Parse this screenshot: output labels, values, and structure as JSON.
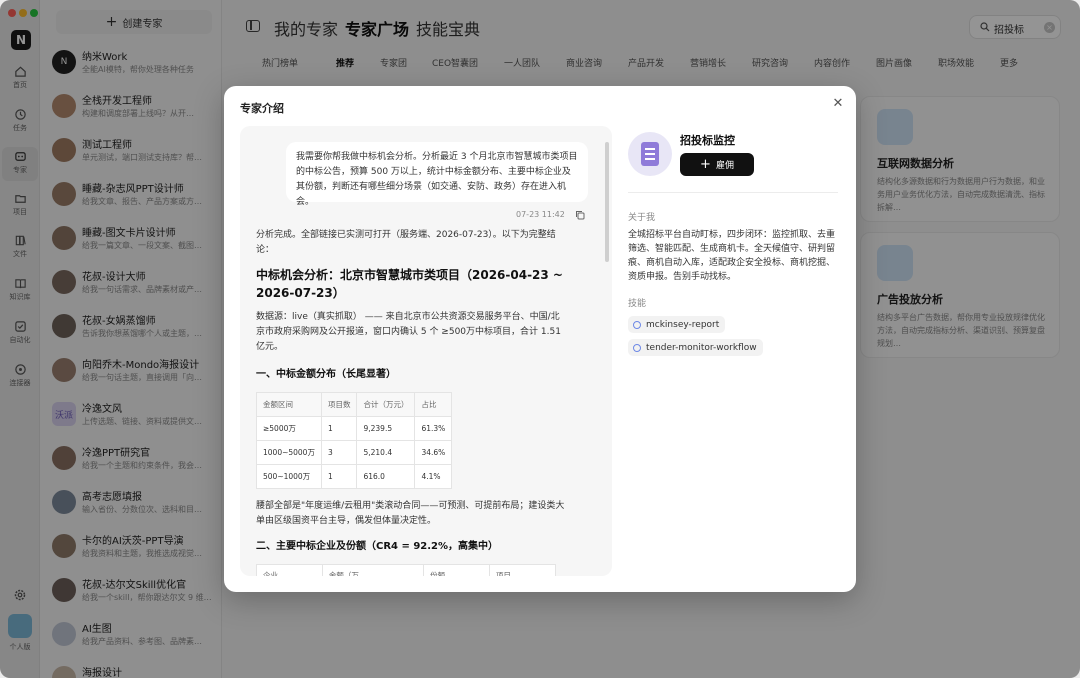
{
  "window": {
    "traffic_lights": [
      "#ff5f57",
      "#febc2e",
      "#28c840"
    ]
  },
  "rail": {
    "logo": "N",
    "items": [
      {
        "label": "首页",
        "icon": "home-icon"
      },
      {
        "label": "任务",
        "icon": "task-icon"
      },
      {
        "label": "专家",
        "icon": "expert-icon",
        "active": true
      },
      {
        "label": "项目",
        "icon": "folder-icon"
      },
      {
        "label": "文件",
        "icon": "file-icon"
      },
      {
        "label": "知识库",
        "icon": "book-icon"
      },
      {
        "label": "自动化",
        "icon": "automation-icon"
      },
      {
        "label": "连接器",
        "icon": "connector-icon"
      }
    ],
    "settings_icon": "gear-icon",
    "profile_label": "个人版"
  },
  "sidebar": {
    "create_label": "创建专家",
    "experts": [
      {
        "name": "纳米Work",
        "desc": "全能AI模特，帮你处理各种任务",
        "avatar_text": "N",
        "avatar_color": "#222222"
      },
      {
        "name": "全栈开发工程师",
        "desc": "构建和调度部署上线吗？从开…",
        "avatar_text": "",
        "avatar_color": "#b48a6e"
      },
      {
        "name": "测试工程师",
        "desc": "单元测试，端口测试支持库？帮…",
        "avatar_text": "",
        "avatar_color": "#a07c63"
      },
      {
        "name": "睡藏-杂志风PPT设计师",
        "desc": "给我文章、报告、产品方案或方…",
        "avatar_text": "",
        "avatar_color": "#9a7d68"
      },
      {
        "name": "睡藏-图文卡片设计师",
        "desc": "给我一篇文章、一段文案、截图…",
        "avatar_text": "",
        "avatar_color": "#8d7565"
      },
      {
        "name": "花叔-设计大师",
        "desc": "给我一句话需求、品牌素材或产…",
        "avatar_text": "",
        "avatar_color": "#7b6a60"
      },
      {
        "name": "花叔-女娲蒸馏师",
        "desc": "告诉我你想蒸馏哪个人或主题，…",
        "avatar_text": "",
        "avatar_color": "#6f625b"
      },
      {
        "name": "向阳乔木-Mondo海报设计",
        "desc": "给我一句话主题，直接调用「向…",
        "avatar_text": "",
        "avatar_color": "#9b8070"
      },
      {
        "name": "冷逸文风",
        "desc": "上传选题、链接、资料或提供文…",
        "avatar_text": "沃派",
        "avatar_color": "#d9d2ef"
      },
      {
        "name": "冷逸PPT研究官",
        "desc": "给我一个主题和约束条件，我会…",
        "avatar_text": "",
        "avatar_color": "#8a7163"
      },
      {
        "name": "高考志愿填报",
        "desc": "输入省份、分数位次、选科和目…",
        "avatar_text": "",
        "avatar_color": "#7d8a9c"
      },
      {
        "name": "卡尔的AI沃茨-PPT导演",
        "desc": "给我资料和主题，我推选成视觉…",
        "avatar_text": "",
        "avatar_color": "#8f7a6a"
      },
      {
        "name": "花叔-达尔文Skill优化官",
        "desc": "给我一个skill，帮你跟达尔文 9 维…",
        "avatar_text": "",
        "avatar_color": "#6d605a"
      },
      {
        "name": "AI生图",
        "desc": "给我产品资料、参考图、品牌素…",
        "avatar_text": "",
        "avatar_color": "#c2c8d6"
      },
      {
        "name": "海报设计",
        "desc": "",
        "avatar_text": "",
        "avatar_color": "#c9b8a8"
      }
    ]
  },
  "header": {
    "panel_icon": "sidebar-toggle-icon",
    "tabs": [
      {
        "label": "我的专家",
        "active": false
      },
      {
        "label": "专家广场",
        "active": true
      },
      {
        "label": "技能宝典",
        "active": false
      }
    ],
    "search_value": "招投标",
    "search_icon": "search-icon"
  },
  "categories": [
    "热门榜单",
    "推荐",
    "专家团",
    "CEO智囊团",
    "一人团队",
    "商业咨询",
    "产品开发",
    "营销增长",
    "研究咨询",
    "内容创作",
    "图片画像",
    "职场效能",
    "更多"
  ],
  "bg_cards": [
    {
      "title": "互联网数据分析",
      "desc": "结构化多源数据和行为数据用户行为数据，和业务用户业务优化方法，自动完成数据清洗、指标拆解…",
      "color": "#cfe3f6"
    },
    {
      "title": "广告投放分析",
      "desc": "结构多平台广告数据，帮你用专业投放规律优化方法，自动完成指标分析、渠道识别、预算复盘规划…",
      "color": "#d7e6f3"
    }
  ],
  "modal": {
    "title": "专家介绍",
    "close_icon": "close-icon",
    "chat": {
      "user_message": "我需要你帮我做中标机会分析。分析最近 3 个月北京市智慧城市类项目的中标公告，预算 500 万以上，统计中标金额分布、主要中标企业及其份额，判断还有哪些细分场景（如交通、安防、政务）存在进入机会。",
      "time": "07-23 11:42",
      "copy_icon": "copy-icon",
      "reply_intro": "分析完成。全部链接已实测可打开（服务端、2026-07-23）。以下为完整结论：",
      "reply_title": "中标机会分析：北京市智慧城市类项目（2026-04-23 ~ 2026-07-23）",
      "source_text": "数据源：live（真实抓取） —— 来自北京市公共资源交易服务平台、中国/北京市政府采购网及公开报道，窗口内确认 5 个 ≥500万中标项目，合计 1.51 亿元。",
      "section1": "一、中标金额分布（长尾显著）",
      "dist_table": {
        "headers": [
          "金额区间",
          "项目数",
          "合计（万元）",
          "占比"
        ],
        "rows": [
          [
            "≥5000万",
            "1",
            "9,239.5",
            "61.3%"
          ],
          [
            "1000~5000万",
            "3",
            "5,210.4",
            "34.6%"
          ],
          [
            "500~1000万",
            "1",
            "616.0",
            "4.1%"
          ]
        ]
      },
      "note": "腰部全部是\"年度运维/云租用\"类滚动合同——可预测、可提前布局；建设类大单由区级国资平台主导，偶发但体量决定性。",
      "section2": "二、主要中标企业及份额（CR4 = 92.2%，高集中）",
      "share_headers": [
        "企业",
        "金额（万",
        "份额",
        "项目"
      ]
    },
    "expert": {
      "name": "招投标监控",
      "hire_label": "雇佣",
      "about_heading": "关于我",
      "about_text": "全城招标平台自动盯标，四步闭环：监控抓取、去重筛选、智能匹配、生成商机卡。全天候值守、研判留痕、商机自动入库，适配政企安全投标、商机挖掘、资质申报。告别手动找标。",
      "skills_heading": "技能",
      "skills": [
        "mckinsey-report",
        "tender-monitor-workflow"
      ],
      "skill_icon": "link-icon"
    }
  }
}
